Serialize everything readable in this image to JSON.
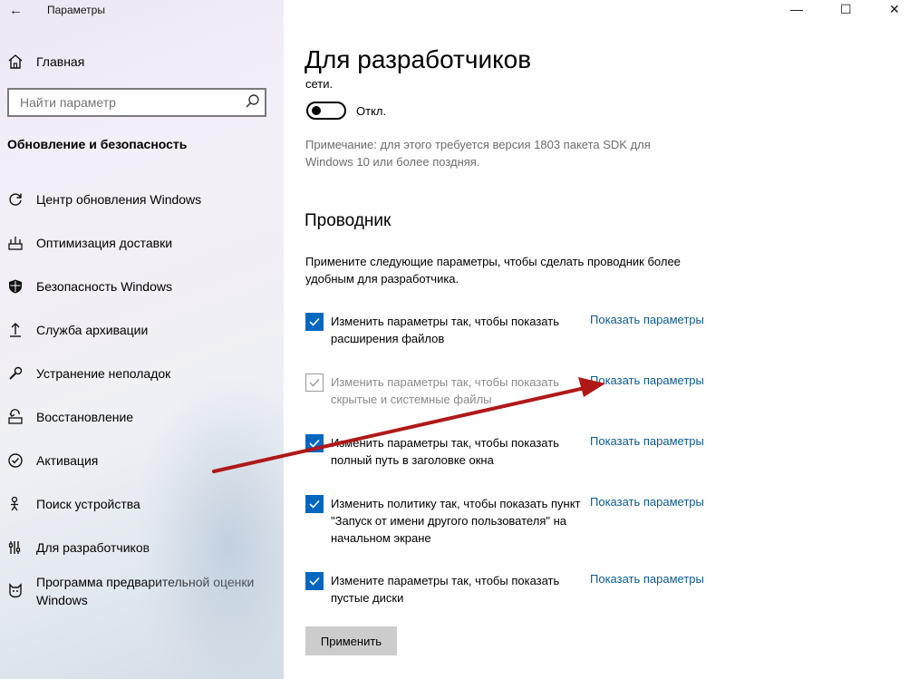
{
  "window": {
    "title": "Параметры",
    "controls": {
      "minimize": "—",
      "maximize": "☐",
      "close": "✕"
    }
  },
  "sidebar": {
    "home_label": "Главная",
    "search_placeholder": "Найти параметр",
    "section_title": "Обновление и безопасность",
    "items": [
      {
        "label": "Центр обновления Windows",
        "icon": "sync-icon"
      },
      {
        "label": "Оптимизация доставки",
        "icon": "delivery-optimization-icon"
      },
      {
        "label": "Безопасность Windows",
        "icon": "shield-icon"
      },
      {
        "label": "Служба архивации",
        "icon": "backup-arrow-icon"
      },
      {
        "label": "Устранение неполадок",
        "icon": "wrench-icon"
      },
      {
        "label": "Восстановление",
        "icon": "recovery-icon"
      },
      {
        "label": "Активация",
        "icon": "check-circle-icon"
      },
      {
        "label": "Поиск устройства",
        "icon": "person-location-icon"
      },
      {
        "label": "Для разработчиков",
        "icon": "developer-tools-icon"
      },
      {
        "label": "Программа предварительной оценки Windows",
        "icon": "insider-cat-icon"
      }
    ]
  },
  "main": {
    "title": "Для разработчиков",
    "network_fragment": "сети.",
    "toggle_state": "Откл.",
    "note": "Примечание: для этого требуется версия 1803 пакета SDK для Windows 10 или более поздняя.",
    "explorer": {
      "heading": "Проводник",
      "description": "Примените следующие параметры, чтобы сделать проводник более удобным для разработчика.",
      "options": [
        {
          "text": "Изменить параметры так, чтобы показать расширения файлов",
          "checked": true,
          "enabled": true,
          "link": "Показать параметры"
        },
        {
          "text": "Изменить параметры так, чтобы показать скрытые и системные файлы",
          "checked": true,
          "enabled": false,
          "link": "Показать параметры"
        },
        {
          "text": "Изменить параметры так, чтобы показать полный путь в заголовке окна",
          "checked": true,
          "enabled": true,
          "link": "Показать параметры"
        },
        {
          "text": "Изменить политику так, чтобы показать пункт \"Запуск от имени другого пользователя\" на начальном экране",
          "checked": true,
          "enabled": true,
          "link": "Показать параметры"
        },
        {
          "text": "Измените параметры так, чтобы показать пустые диски",
          "checked": true,
          "enabled": true,
          "link": "Показать параметры"
        }
      ],
      "apply_label": "Применить"
    }
  },
  "colors": {
    "accent": "#0067c0",
    "link": "#0a5c94",
    "annotation_arrow": "#b01818"
  }
}
